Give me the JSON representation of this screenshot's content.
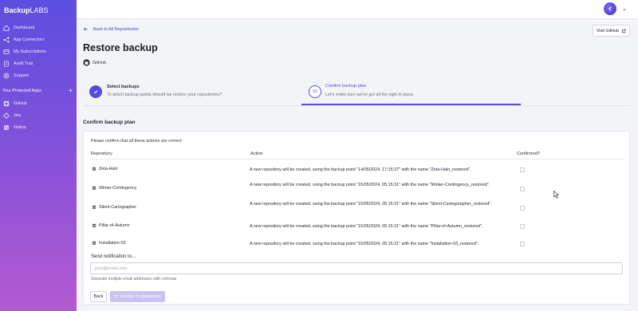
{
  "app": {
    "logo_main": "Backup",
    "logo_suffix": "LABS"
  },
  "sidebar": {
    "items": [
      {
        "label": "Dashboard",
        "icon": "home-icon"
      },
      {
        "label": "App Connectors",
        "icon": "share-icon"
      },
      {
        "label": "My Subscriptions",
        "icon": "card-icon"
      },
      {
        "label": "Audit Trail",
        "icon": "list-icon"
      },
      {
        "label": "Support",
        "icon": "help-icon"
      }
    ],
    "protected_title": "Your Protected Apps",
    "protected_add": "+",
    "apps": [
      {
        "label": "GitHub",
        "icon": "github-icon"
      },
      {
        "label": "Jira",
        "icon": "jira-icon"
      },
      {
        "label": "Notion",
        "icon": "notion-icon"
      }
    ]
  },
  "header": {
    "avatar_chevron": "⌄"
  },
  "main": {
    "back_label": "Back to All Repositories",
    "visit_label": "Visit GitHub",
    "title": "Restore backup",
    "provider": "GitHub.",
    "steps": [
      {
        "title": "Select backups",
        "subtitle": "To which backup points should we restore your repositories?",
        "status": "done"
      },
      {
        "number": "02",
        "title": "Confirm backup plan",
        "subtitle": "Let's make sure we've got all the right in place.",
        "status": "active"
      }
    ],
    "section_heading": "Confirm backup plan",
    "intro": "Please confirm that all these actions are correct:",
    "columns": {
      "repository": "Repository",
      "action": "Action",
      "confirmed": "Confirmed?"
    },
    "rows": [
      {
        "repo": "Zeta-Halo",
        "action": "A new repository will be created, using the backup point \"14/05/2024, 17:15:37\" with the name \"Zeta-Halo_restored\"."
      },
      {
        "repo": "Winter-Contingency",
        "action": "A new repository will be created, using the backup point \"15/05/2024, 05:15:31\" with the name \"Winter-Contingency_restored\"."
      },
      {
        "repo": "Silent-Cartographer",
        "action": "A new repository will be created, using the backup point \"15/05/2024, 05:15:31\" with the name \"Silent-Cartegorapher_restored\"."
      },
      {
        "repo": "Pillar-of-Autumn",
        "action": "A new repository will be created, using the backup point \"15/05/2024, 05:15:31\" with the name \"Pillar-of-Autumn_restored\"."
      },
      {
        "repo": "Installation-03",
        "action": "A new repository will be created, using the backup point \"15/05/2024, 05:15:31\" with the name \"Installation-03_restored\"."
      }
    ],
    "notify_label": "Send notification to...",
    "email_placeholder": "your@email.com",
    "email_help": "Separate multiple email addresses with commas",
    "back_button": "Back",
    "restore_button": "Restore 5 repositories"
  },
  "colors": {
    "accent": "#5a4be0",
    "sidebar_top": "#5b4ee0",
    "sidebar_bottom": "#b45ad0",
    "button_disabled": "#c9c3f2"
  }
}
